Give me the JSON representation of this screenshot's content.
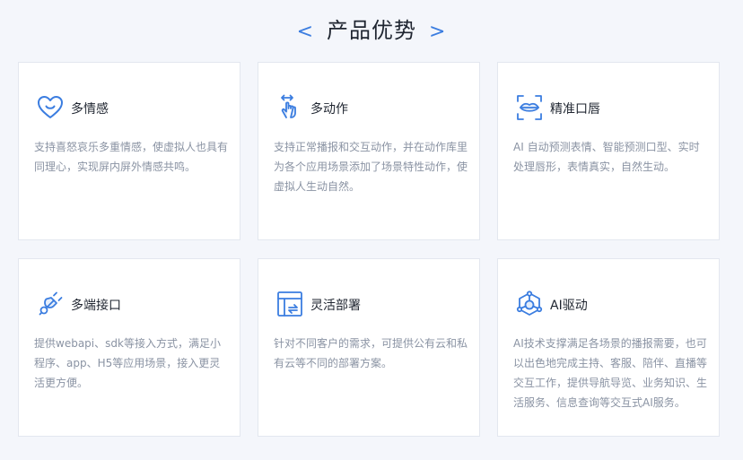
{
  "section": {
    "title": "产品优势",
    "left_chevron": "<",
    "right_chevron": ">"
  },
  "colors": {
    "accent": "#3b7de0",
    "title_text": "#1f2530",
    "desc_text": "#8a93a3",
    "background": "#f4f6fb",
    "card_background": "#ffffff"
  },
  "cards": [
    {
      "icon": "heart-icon",
      "title": "多情感",
      "desc": "支持喜怒哀乐多重情感，使虚拟人也具有同理心，实现屏内屏外情感共鸣。"
    },
    {
      "icon": "hand-tap-icon",
      "title": "多动作",
      "desc": "支持正常播报和交互动作，并在动作库里为各个应用场景添加了场景特性动作，使虚拟人生动自然。"
    },
    {
      "icon": "lip-scan-icon",
      "title": "精准口唇",
      "desc": "AI 自动预测表情、智能预测口型、实时处理唇形，表情真实，自然生动。"
    },
    {
      "icon": "plug-icon",
      "title": "多端接口",
      "desc": "提供webapi、sdk等接入方式，满足小程序、app、H5等应用场景，接入更灵活更方便。"
    },
    {
      "icon": "flexible-deploy-icon",
      "title": "灵活部署",
      "desc": "针对不同客户的需求，可提供公有云和私有云等不同的部署方案。"
    },
    {
      "icon": "ai-hub-icon",
      "title": "AI驱动",
      "desc": "AI技术支撑满足各场景的播报需要，也可以出色地完成主持、客服、陪伴、直播等交互工作，提供导航导览、业务知识、生活服务、信息查询等交互式AI服务。"
    }
  ]
}
